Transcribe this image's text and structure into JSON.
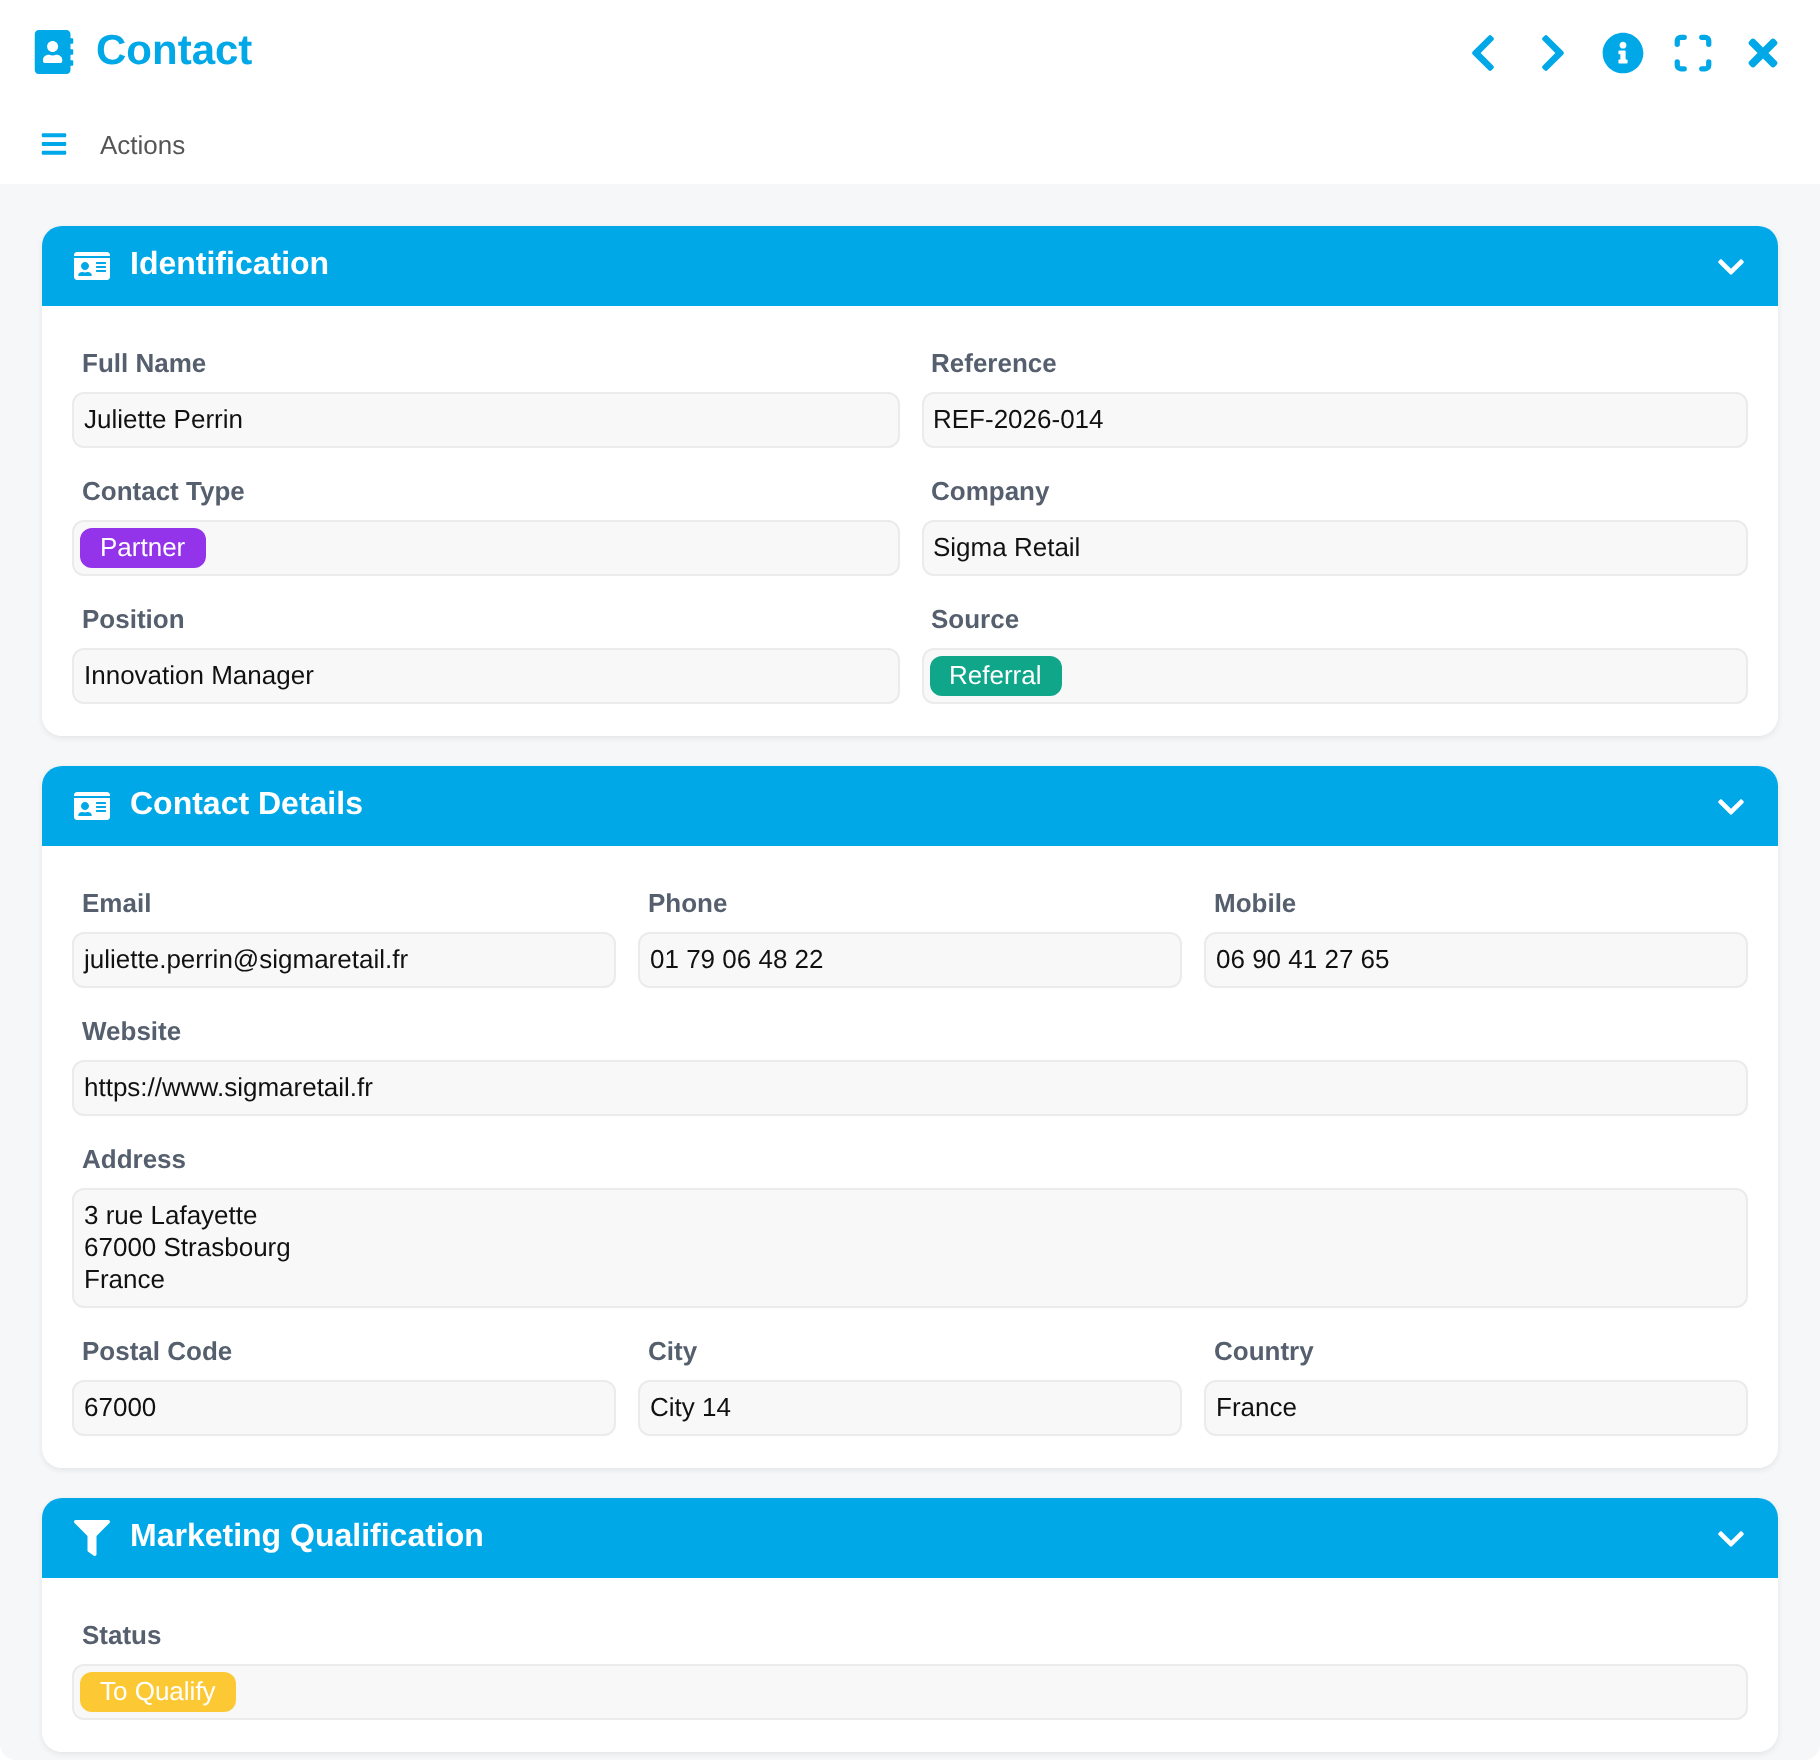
{
  "window": {
    "title": "Contact"
  },
  "toolbar": {
    "actions_label": "Actions"
  },
  "sections": [
    {
      "title": "Identification",
      "expanded": true,
      "rows": [
        [
          {
            "label": "Full Name",
            "kind": "text",
            "value": "Juliette Perrin"
          },
          {
            "label": "Reference",
            "kind": "text",
            "value": "REF-2026-014"
          }
        ],
        [
          {
            "label": "Contact Type",
            "kind": "tag",
            "value": "Partner",
            "color": "#9333ea"
          },
          {
            "label": "Company",
            "kind": "text",
            "value": "Sigma Retail"
          }
        ],
        [
          {
            "label": "Position",
            "kind": "text",
            "value": "Innovation Manager"
          },
          {
            "label": "Source",
            "kind": "tag",
            "value": "Referral",
            "color": "#0fa68a"
          }
        ]
      ]
    },
    {
      "title": "Contact Details",
      "expanded": true,
      "rows": [
        [
          {
            "label": "Email",
            "kind": "text",
            "value": "juliette.perrin@sigmaretail.fr"
          },
          {
            "label": "Phone",
            "kind": "text",
            "value": "01 79 06 48 22"
          },
          {
            "label": "Mobile",
            "kind": "text",
            "value": "06 90 41 27 65"
          }
        ],
        [
          {
            "label": "Website",
            "kind": "text",
            "value": "https://www.sigmaretail.fr"
          }
        ],
        [
          {
            "label": "Address",
            "kind": "multiline",
            "lines": [
              "3 rue Lafayette",
              "67000 Strasbourg",
              "France"
            ]
          }
        ],
        [
          {
            "label": "Postal Code",
            "kind": "text",
            "value": "67000"
          },
          {
            "label": "City",
            "kind": "text",
            "value": "City 14"
          },
          {
            "label": "Country",
            "kind": "text",
            "value": "France"
          }
        ]
      ]
    },
    {
      "title": "Marketing Qualification",
      "expanded": true,
      "rows": [
        [
          {
            "label": "Status",
            "kind": "tag",
            "value": "To Qualify",
            "color": "#fcc934"
          }
        ]
      ]
    }
  ]
}
